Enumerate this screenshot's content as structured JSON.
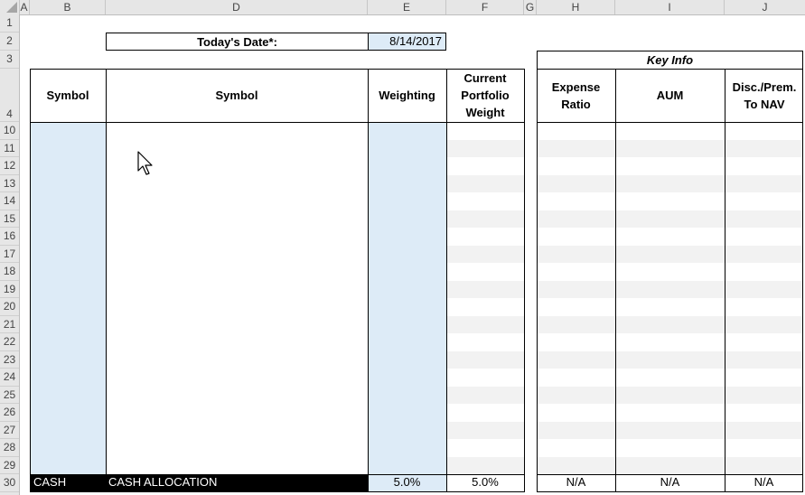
{
  "columns": [
    "A",
    "B",
    "D",
    "E",
    "F",
    "G",
    "H",
    "I",
    "J"
  ],
  "rows": [
    "1",
    "2",
    "3",
    "4",
    "10",
    "11",
    "12",
    "13",
    "14",
    "15",
    "16",
    "17",
    "18",
    "19",
    "20",
    "21",
    "22",
    "23",
    "24",
    "25",
    "26",
    "27",
    "28",
    "29",
    "30"
  ],
  "date_label": "Today's Date*:",
  "date_value": "8/14/2017",
  "key_info_label": "Key Info",
  "headers": {
    "symbol_b": "Symbol",
    "symbol_d": "Symbol",
    "weighting": "Weighting",
    "current_portfolio_weight": "Current Portfolio Weight",
    "expense_ratio": "Expense Ratio",
    "aum": "AUM",
    "disc_prem": "Disc./Prem. To NAV"
  },
  "cash_row": {
    "symbol": "CASH",
    "label": "CASH ALLOCATION",
    "weighting": "5.0%",
    "current_weight": "5.0%",
    "expense_ratio": "N/A",
    "aum": "N/A",
    "disc_prem": "N/A"
  },
  "colors": {
    "input_blue": "#ddebf7",
    "header_gray": "#e6e6e6",
    "band_gray": "#f2f2f2",
    "cash_black": "#000000"
  },
  "icons": [
    "select-all-icon",
    "mouse-pointer-icon"
  ]
}
